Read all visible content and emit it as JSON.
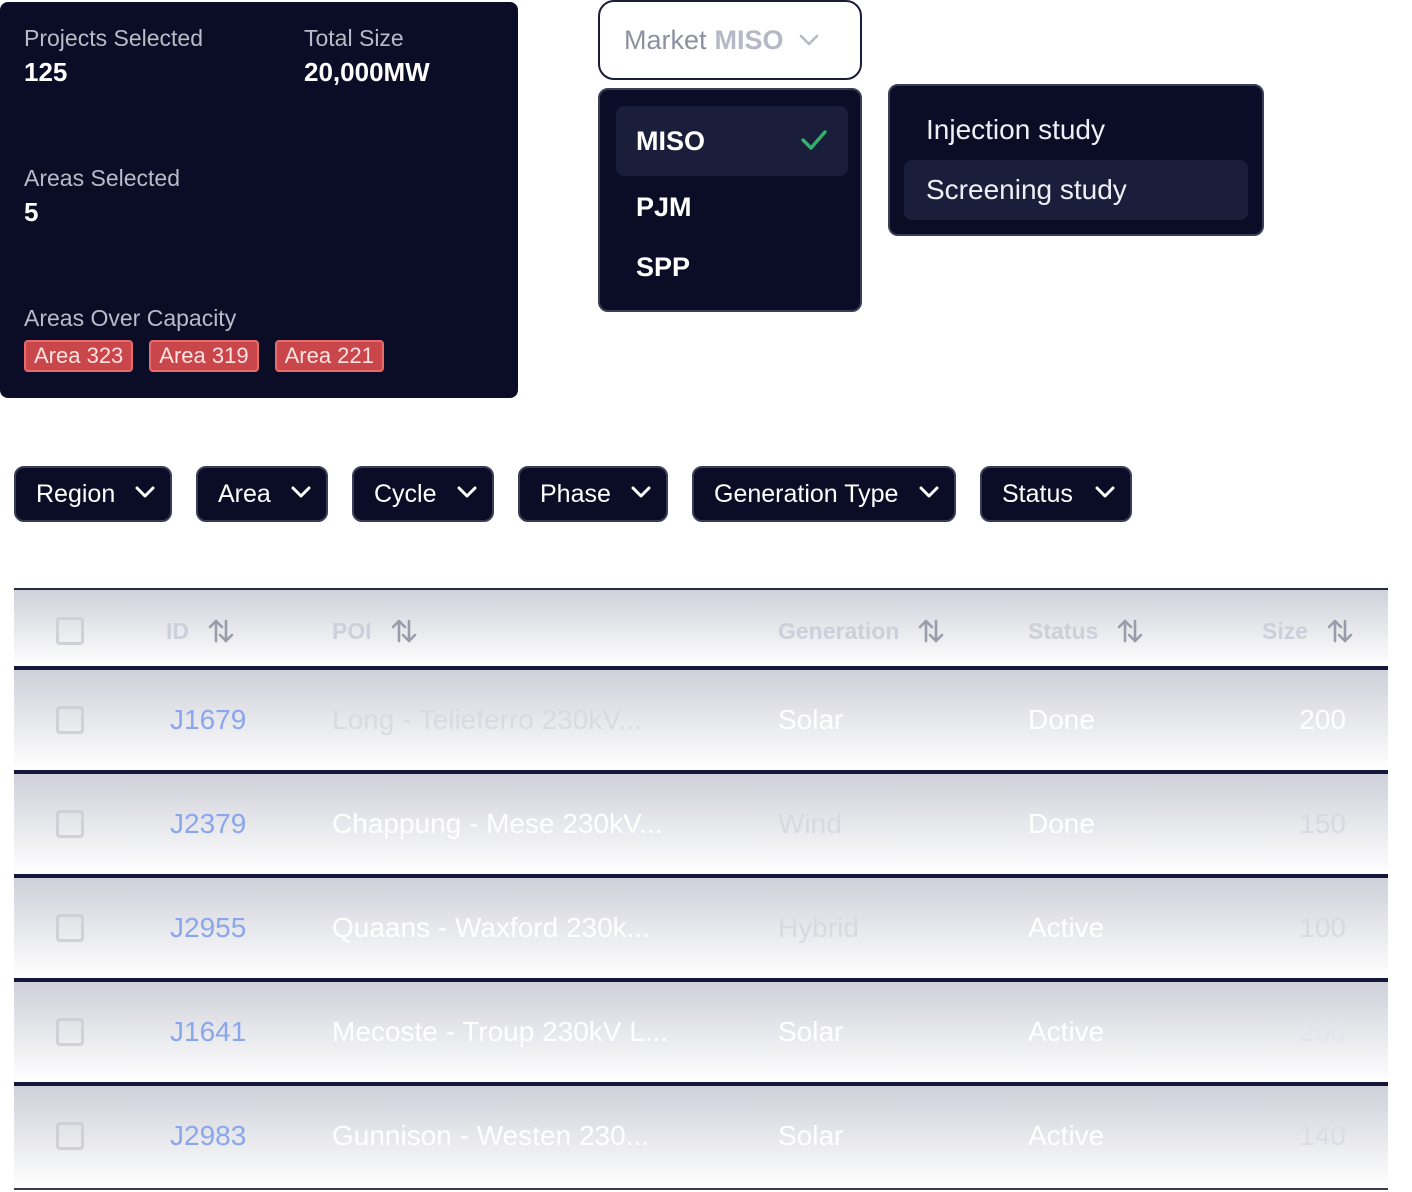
{
  "summary": {
    "projects_selected_label": "Projects Selected",
    "projects_selected_value": "125",
    "total_size_label": "Total Size",
    "total_size_value": "20,000MW",
    "areas_selected_label": "Areas Selected",
    "areas_selected_value": "5",
    "areas_over_capacity_label": "Areas Over Capacity",
    "over_capacity_tags": [
      "Area 323",
      "Area 319",
      "Area 221"
    ]
  },
  "market": {
    "label": "Market",
    "selected": "MISO",
    "options": [
      "MISO",
      "PJM",
      "SPP"
    ]
  },
  "study_menu": {
    "options": [
      "Injection study",
      "Screening study"
    ],
    "highlighted": "Screening study"
  },
  "filters": [
    "Region",
    "Area",
    "Cycle",
    "Phase",
    "Generation Type",
    "Status"
  ],
  "table": {
    "headers": {
      "id": "ID",
      "poi": "POI",
      "generation": "Generation",
      "status": "Status",
      "size": "Size"
    },
    "rows": [
      {
        "id": "J1679",
        "poi": "Long - Telieferro 230kV...",
        "generation": "Solar",
        "status": "Done",
        "size": "200"
      },
      {
        "id": "J2379",
        "poi": "Chappung - Mese 230kV...",
        "generation": "Wind",
        "status": "Done",
        "size": "150"
      },
      {
        "id": "J2955",
        "poi": "Quaans - Waxford 230k...",
        "generation": "Hybrid",
        "status": "Active",
        "size": "100"
      },
      {
        "id": "J1641",
        "poi": "Mecoste - Troup 230kV L...",
        "generation": "Solar",
        "status": "Active",
        "size": "200"
      },
      {
        "id": "J2983",
        "poi": "Gunnison - Westen 230...",
        "generation": "Solar",
        "status": "Active",
        "size": "140"
      }
    ]
  },
  "colors": {
    "panel_bg": "#0b0d26",
    "tag_red": "#c9464a",
    "check_green": "#2fb26a",
    "link_blue": "#8aa6ec"
  }
}
